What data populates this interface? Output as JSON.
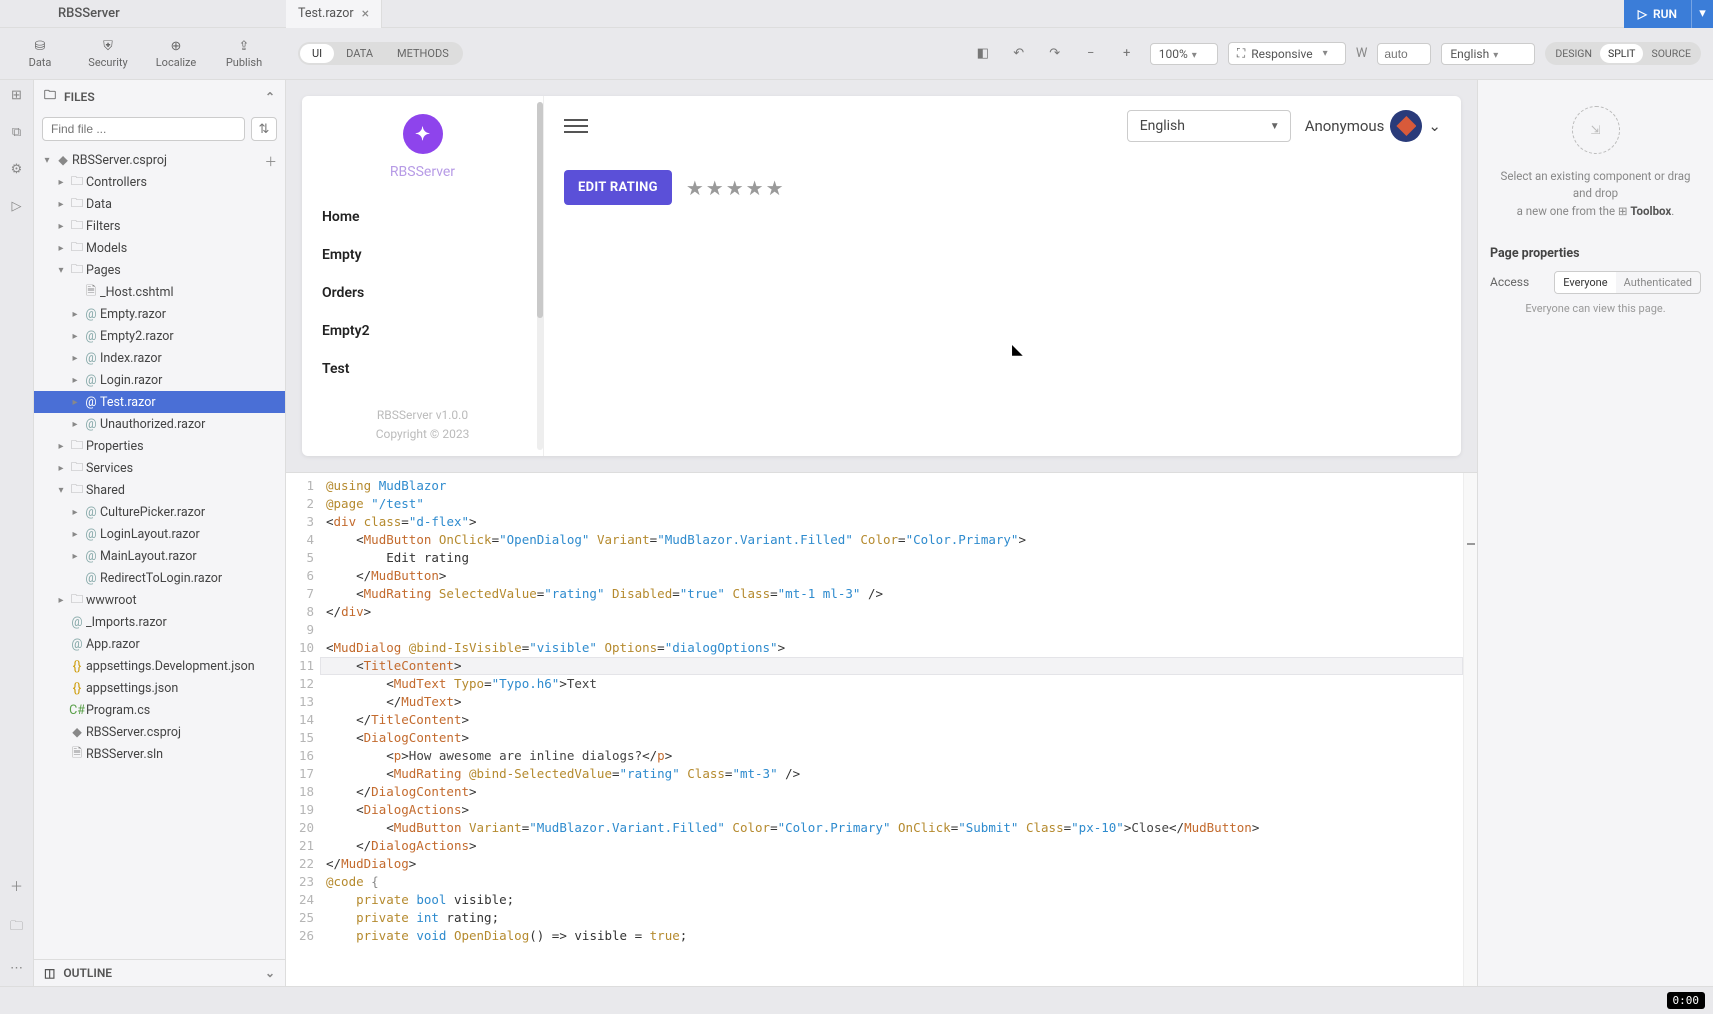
{
  "titlebar": {
    "project": "RBSServer",
    "tab": "Test.razor"
  },
  "run": {
    "label": "RUN"
  },
  "toolbar_left": [
    {
      "id": "data",
      "label": "Data"
    },
    {
      "id": "security",
      "label": "Security"
    },
    {
      "id": "localize",
      "label": "Localize"
    },
    {
      "id": "publish",
      "label": "Publish"
    }
  ],
  "view_tabs": {
    "ui": "UI",
    "data": "DATA",
    "methods": "METHODS"
  },
  "zoom": "100%",
  "device": "Responsive",
  "width_label": "W",
  "width_value": "auto",
  "lang": "English",
  "mode": {
    "design": "DESIGN",
    "split": "SPLIT",
    "source": "SOURCE"
  },
  "files": {
    "header": "FILES",
    "search_placeholder": "Find file ...",
    "tree": [
      {
        "d": 0,
        "caret": "▾",
        "icon": "proj",
        "label": "RBSServer.csproj",
        "plus": true
      },
      {
        "d": 1,
        "caret": "▸",
        "icon": "folder",
        "label": "Controllers"
      },
      {
        "d": 1,
        "caret": "▸",
        "icon": "folder",
        "label": "Data"
      },
      {
        "d": 1,
        "caret": "▸",
        "icon": "folder",
        "label": "Filters"
      },
      {
        "d": 1,
        "caret": "▸",
        "icon": "folder",
        "label": "Models"
      },
      {
        "d": 1,
        "caret": "▾",
        "icon": "folder",
        "label": "Pages"
      },
      {
        "d": 2,
        "caret": "",
        "icon": "file",
        "label": "_Host.cshtml"
      },
      {
        "d": 2,
        "caret": "▸",
        "icon": "at",
        "label": "Empty.razor"
      },
      {
        "d": 2,
        "caret": "▸",
        "icon": "at",
        "label": "Empty2.razor"
      },
      {
        "d": 2,
        "caret": "▸",
        "icon": "at",
        "label": "Index.razor"
      },
      {
        "d": 2,
        "caret": "▸",
        "icon": "at",
        "label": "Login.razor"
      },
      {
        "d": 2,
        "caret": "▸",
        "icon": "at",
        "label": "Test.razor",
        "selected": true
      },
      {
        "d": 2,
        "caret": "▸",
        "icon": "at",
        "label": "Unauthorized.razor"
      },
      {
        "d": 1,
        "caret": "▸",
        "icon": "folder",
        "label": "Properties"
      },
      {
        "d": 1,
        "caret": "▸",
        "icon": "folder",
        "label": "Services"
      },
      {
        "d": 1,
        "caret": "▾",
        "icon": "folder",
        "label": "Shared"
      },
      {
        "d": 2,
        "caret": "▸",
        "icon": "at",
        "label": "CulturePicker.razor"
      },
      {
        "d": 2,
        "caret": "▸",
        "icon": "at",
        "label": "LoginLayout.razor"
      },
      {
        "d": 2,
        "caret": "▸",
        "icon": "at",
        "label": "MainLayout.razor"
      },
      {
        "d": 2,
        "caret": "",
        "icon": "at",
        "label": "RedirectToLogin.razor"
      },
      {
        "d": 1,
        "caret": "▸",
        "icon": "folder",
        "label": "wwwroot"
      },
      {
        "d": 1,
        "caret": "",
        "icon": "at",
        "label": "_Imports.razor"
      },
      {
        "d": 1,
        "caret": "",
        "icon": "at",
        "label": "App.razor"
      },
      {
        "d": 1,
        "caret": "",
        "icon": "braces",
        "label": "appsettings.Development.json"
      },
      {
        "d": 1,
        "caret": "",
        "icon": "braces",
        "label": "appsettings.json"
      },
      {
        "d": 1,
        "caret": "",
        "icon": "cs",
        "label": "Program.cs"
      },
      {
        "d": 1,
        "caret": "",
        "icon": "proj",
        "label": "RBSServer.csproj"
      },
      {
        "d": 1,
        "caret": "",
        "icon": "file",
        "label": "RBSServer.sln"
      }
    ],
    "outline": "OUTLINE"
  },
  "preview": {
    "brand": "RBSServer",
    "nav": [
      "Home",
      "Empty",
      "Orders",
      "Empty2",
      "Test"
    ],
    "footer1": "RBSServer v1.0.0",
    "footer2": "Copyright © 2023",
    "lang": "English",
    "user": "Anonymous",
    "edit_btn": "EDIT RATING"
  },
  "code": {
    "lines": [
      {
        "n": 1,
        "html": "<span class='tk-dir'>@using</span> <span class='tk-type'>MudBlazor</span>"
      },
      {
        "n": 2,
        "html": "<span class='tk-dir'>@page</span> <span class='tk-str'>\"/test\"</span>"
      },
      {
        "n": 3,
        "html": "&lt;<span class='tk-tag'>div</span> <span class='tk-attr'>class</span>=<span class='tk-str'>\"d-flex\"</span>&gt;"
      },
      {
        "n": 4,
        "html": "    &lt;<span class='tk-tag'>MudButton</span> <span class='tk-attr'>OnClick</span>=<span class='tk-str'>\"OpenDialog\"</span> <span class='tk-attr'>Variant</span>=<span class='tk-str'>\"MudBlazor.Variant.Filled\"</span> <span class='tk-attr'>Color</span>=<span class='tk-str'>\"Color.Primary\"</span>&gt;"
      },
      {
        "n": 5,
        "html": "        Edit rating"
      },
      {
        "n": 6,
        "html": "    &lt;/<span class='tk-tag'>MudButton</span>&gt;"
      },
      {
        "n": 7,
        "html": "    &lt;<span class='tk-tag'>MudRating</span> <span class='tk-attr'>SelectedValue</span>=<span class='tk-str'>\"rating\"</span> <span class='tk-attr'>Disabled</span>=<span class='tk-str'>\"true\"</span> <span class='tk-attr'>Class</span>=<span class='tk-str'>\"mt-1 ml-3\"</span> /&gt;"
      },
      {
        "n": 8,
        "html": "&lt;/<span class='tk-tag'>div</span>&gt;"
      },
      {
        "n": 9,
        "html": ""
      },
      {
        "n": 10,
        "html": "&lt;<span class='tk-tag'>MudDialog</span> <span class='tk-attr'>@bind-IsVisible</span>=<span class='tk-str'>\"visible\"</span> <span class='tk-attr'>Options</span>=<span class='tk-str'>\"dialogOptions\"</span>&gt;"
      },
      {
        "n": 11,
        "hl": true,
        "html": "    &lt;<span class='tk-tag'>TitleContent</span>&gt;"
      },
      {
        "n": 12,
        "html": "        &lt;<span class='tk-tag'>MudText</span> <span class='tk-attr'>Typo</span>=<span class='tk-str'>\"Typo.h6\"</span>&gt;<span class='tk-txt'>Text</span>"
      },
      {
        "n": 13,
        "html": "        &lt;/<span class='tk-tag'>MudText</span>&gt;"
      },
      {
        "n": 14,
        "html": "    &lt;/<span class='tk-tag'>TitleContent</span>&gt;"
      },
      {
        "n": 15,
        "html": "    &lt;<span class='tk-tag'>DialogContent</span>&gt;"
      },
      {
        "n": 16,
        "html": "        &lt;<span class='tk-tag'>p</span>&gt;<span class='tk-txt'>How awesome are inline dialogs?</span>&lt;/<span class='tk-tag'>p</span>&gt;"
      },
      {
        "n": 17,
        "html": "        &lt;<span class='tk-tag'>MudRating</span> <span class='tk-attr'>@bind-SelectedValue</span>=<span class='tk-str'>\"rating\"</span> <span class='tk-attr'>Class</span>=<span class='tk-str'>\"mt-3\"</span> /&gt;"
      },
      {
        "n": 18,
        "html": "    &lt;/<span class='tk-tag'>DialogContent</span>&gt;"
      },
      {
        "n": 19,
        "html": "    &lt;<span class='tk-tag'>DialogActions</span>&gt;"
      },
      {
        "n": 20,
        "html": "        &lt;<span class='tk-tag'>MudButton</span> <span class='tk-attr'>Variant</span>=<span class='tk-str'>\"MudBlazor.Variant.Filled\"</span> <span class='tk-attr'>Color</span>=<span class='tk-str'>\"Color.Primary\"</span> <span class='tk-attr'>OnClick</span>=<span class='tk-str'>\"Submit\"</span> <span class='tk-attr'>Class</span>=<span class='tk-str'>\"px-10\"</span>&gt;<span class='tk-txt'>Close</span>&lt;/<span class='tk-tag'>MudButton</span>&gt;"
      },
      {
        "n": 21,
        "html": "    &lt;/<span class='tk-tag'>DialogActions</span>&gt;"
      },
      {
        "n": 22,
        "html": "&lt;/<span class='tk-tag'>MudDialog</span>&gt;"
      },
      {
        "n": 23,
        "html": "<span class='tk-dir'>@code</span> <span class='tk-punc'>{</span>"
      },
      {
        "n": 24,
        "html": "    <span class='tk-kw'>private</span> <span class='tk-type'>bool</span> visible;"
      },
      {
        "n": 25,
        "html": "    <span class='tk-kw'>private</span> <span class='tk-type'>int</span> rating;"
      },
      {
        "n": 26,
        "html": "    <span class='tk-kw'>private</span> <span class='tk-type'>void</span> <span class='tk-attr'>OpenDialog</span>() =&gt; visible = <span class='tk-kw'>true</span>;"
      }
    ]
  },
  "rightpanel": {
    "hint_a": "Select an existing component or drag and drop",
    "hint_b": "a new one from the ",
    "hint_c": "Toolbox",
    "section": "Page properties",
    "access_label": "Access",
    "everyone": "Everyone",
    "auth": "Authenticated",
    "note": "Everyone can view this page."
  },
  "status": {
    "time": "0:00"
  }
}
